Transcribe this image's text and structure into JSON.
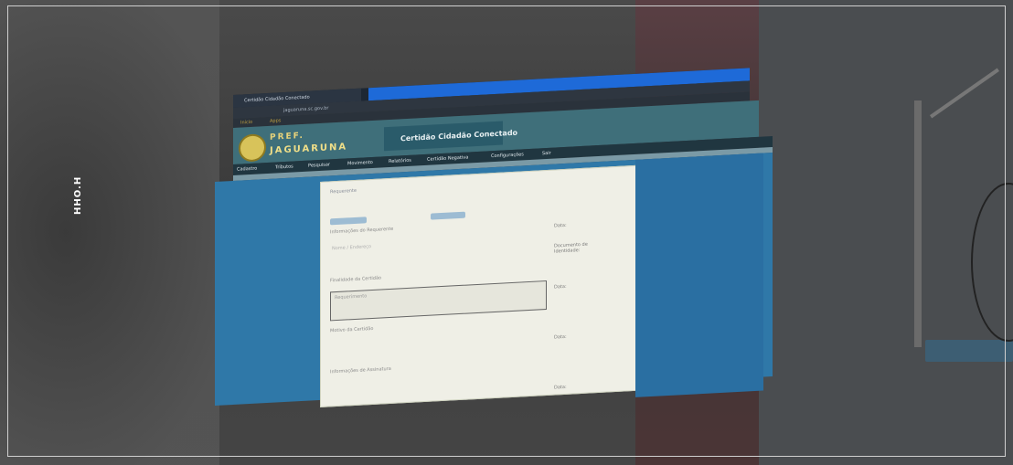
{
  "photo": {
    "side_text": "HHO.H",
    "colors": {
      "screen_blue": "#2f78a8",
      "header_teal": "#3f6f7a",
      "titlebar_blue": "#1e6ad8"
    }
  },
  "browser": {
    "tab_title": "Certidão Cidadão Conectado",
    "address": "jaguaruna.sc.gov.br",
    "bookmarks": [
      "Inicio",
      "Apps"
    ]
  },
  "site": {
    "brand_line1": "PREF.",
    "brand_line2": "JAGUARUNA",
    "certificate_title": "Certidão Cidadão Conectado",
    "nav": [
      "Cadastro",
      "Tributos",
      "Pesquisar",
      "Movimento",
      "Relatórios",
      "Certidão Negativa",
      "Configurações",
      "Sair"
    ]
  },
  "modal": {
    "title": "Requerente",
    "section1": "Informações do Requerente",
    "field_lines": "Nome / Endereço",
    "section2": "Finalidade da Certidão",
    "box_text": "Requerimento",
    "section3": "Motivo da Certidão",
    "section4": "Informações de Assinatura",
    "right_labels": [
      "Data:",
      "Documento de Identidade:",
      "Data:",
      "Data:",
      "Data:"
    ]
  }
}
